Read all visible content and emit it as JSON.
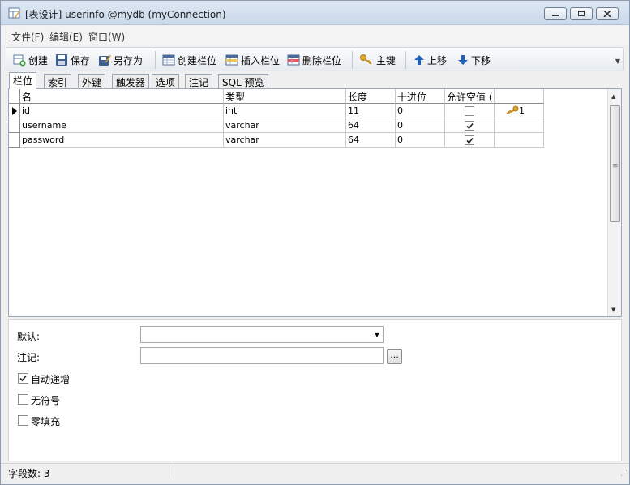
{
  "window": {
    "title": "[表设计] userinfo @mydb (myConnection)"
  },
  "menu": [
    {
      "label": "文件(F)"
    },
    {
      "label": "编辑(E)"
    },
    {
      "label": "窗口(W)"
    }
  ],
  "toolbar": {
    "create": "创建",
    "save": "保存",
    "save_as": "另存为",
    "create_field": "创建栏位",
    "insert_field": "插入栏位",
    "delete_field": "删除栏位",
    "primary_key": "主键",
    "move_up": "上移",
    "move_down": "下移"
  },
  "tabs": [
    {
      "label": "栏位",
      "active": true
    },
    {
      "label": "索引"
    },
    {
      "label": "外键"
    },
    {
      "label": "触发器"
    },
    {
      "label": "选项"
    },
    {
      "label": "注记"
    },
    {
      "label": "SQL 预览"
    }
  ],
  "grid": {
    "headers": [
      "名",
      "类型",
      "长度",
      "十进位",
      "允许空值 (",
      ""
    ],
    "rows": [
      {
        "name": "id",
        "type": "int",
        "length": "11",
        "decimals": "0",
        "allow_null": false,
        "key": "1"
      },
      {
        "name": "username",
        "type": "varchar",
        "length": "64",
        "decimals": "0",
        "allow_null": true,
        "key": ""
      },
      {
        "name": "password",
        "type": "varchar",
        "length": "64",
        "decimals": "0",
        "allow_null": true,
        "key": ""
      }
    ]
  },
  "properties": {
    "default_label": "默认:",
    "comment_label": "注记:",
    "default_value": "",
    "comment_value": "",
    "auto_increment_label": "自动递增",
    "auto_increment": true,
    "unsigned_label": "无符号",
    "unsigned": false,
    "zerofill_label": "零填充",
    "zerofill": false
  },
  "status": {
    "field_count": "字段数: 3"
  },
  "colors": {
    "key_icon": "#d9a520",
    "arrow_blue": "#1f5fbf"
  }
}
